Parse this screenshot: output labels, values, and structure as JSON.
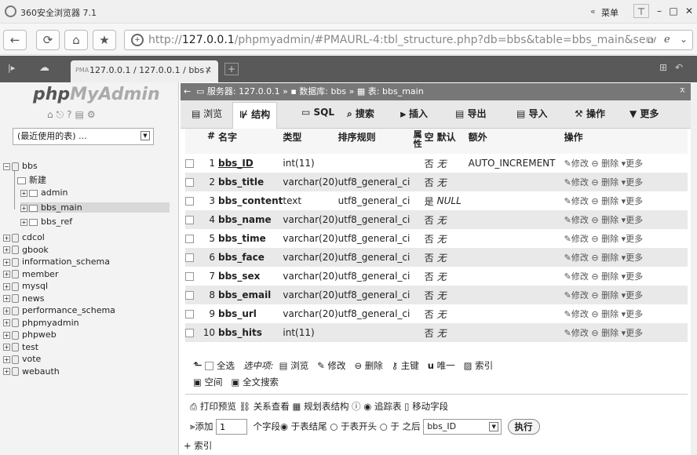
{
  "window": {
    "title": "360安全浏览器 7.1",
    "menu_label": "菜单"
  },
  "address": {
    "url_prefix": "http://",
    "url_host": "127.0.0.1",
    "url_rest": "/phpmyadmin/#PMAURL-4:tbl_structure.php?db=bbs&table=bbs_main&serv"
  },
  "tab": {
    "title": "127.0.0.1 / 127.0.0.1 / bbs /"
  },
  "left": {
    "logo_php": "php",
    "logo_myadmin": "MyAdmin",
    "recent": "(最近使用的表) ...",
    "tree": {
      "bbs": "bbs",
      "new": "新建",
      "admin": "admin",
      "bbs_main": "bbs_main",
      "bbs_ref": "bbs_ref",
      "dbs": [
        "cdcol",
        "gbook",
        "information_schema",
        "member",
        "mysql",
        "news",
        "performance_schema",
        "phpmyadmin",
        "phpweb",
        "test",
        "vote",
        "webauth"
      ]
    }
  },
  "breadcrumb": {
    "server": "服务器: 127.0.0.1",
    "db": "数据库: bbs",
    "table": "表: bbs_main"
  },
  "tabs": {
    "browse": "浏览",
    "structure": "结构",
    "sql": "SQL",
    "search": "搜索",
    "insert": "插入",
    "export": "导出",
    "import": "导入",
    "operations": "操作",
    "more": "更多"
  },
  "headers": {
    "num": "#",
    "name": "名字",
    "type": "类型",
    "collation": "排序规则",
    "attr": "属性",
    "null": "空",
    "default": "默认",
    "extra": "额外",
    "action": "操作"
  },
  "actions": {
    "edit": "修改",
    "drop": "删除",
    "more": "更多"
  },
  "rows": [
    {
      "n": "1",
      "name": "bbs_ID",
      "type": "int(11)",
      "collation": "",
      "null": "否",
      "default": "无",
      "extra": "AUTO_INCREMENT"
    },
    {
      "n": "2",
      "name": "bbs_title",
      "type": "varchar(20)",
      "collation": "utf8_general_ci",
      "null": "否",
      "default": "无",
      "extra": ""
    },
    {
      "n": "3",
      "name": "bbs_content",
      "type": "text",
      "collation": "utf8_general_ci",
      "null": "是",
      "default": "NULL",
      "extra": ""
    },
    {
      "n": "4",
      "name": "bbs_name",
      "type": "varchar(20)",
      "collation": "utf8_general_ci",
      "null": "否",
      "default": "无",
      "extra": ""
    },
    {
      "n": "5",
      "name": "bbs_time",
      "type": "varchar(20)",
      "collation": "utf8_general_ci",
      "null": "否",
      "default": "无",
      "extra": ""
    },
    {
      "n": "6",
      "name": "bbs_face",
      "type": "varchar(20)",
      "collation": "utf8_general_ci",
      "null": "否",
      "default": "无",
      "extra": ""
    },
    {
      "n": "7",
      "name": "bbs_sex",
      "type": "varchar(20)",
      "collation": "utf8_general_ci",
      "null": "否",
      "default": "无",
      "extra": ""
    },
    {
      "n": "8",
      "name": "bbs_email",
      "type": "varchar(20)",
      "collation": "utf8_general_ci",
      "null": "否",
      "default": "无",
      "extra": ""
    },
    {
      "n": "9",
      "name": "bbs_url",
      "type": "varchar(20)",
      "collation": "utf8_general_ci",
      "null": "否",
      "default": "无",
      "extra": ""
    },
    {
      "n": "10",
      "name": "bbs_hits",
      "type": "int(11)",
      "collation": "",
      "null": "否",
      "default": "无",
      "extra": ""
    }
  ],
  "bulk": {
    "check_all": "全选",
    "with_selected": "选中项:",
    "browse": "浏览",
    "change": "修改",
    "drop": "删除",
    "primary": "主键",
    "unique": "唯一",
    "index": "索引",
    "spatial": "空间",
    "fulltext": "全文搜索"
  },
  "bottom": {
    "print": "打印预览",
    "relation": "关系查看",
    "propose": "规划表结构",
    "track": "追踪表",
    "move": "移动字段",
    "add": "添加",
    "add_count": "1",
    "fields": "个字段",
    "at_end": "于表结尾",
    "at_begin": "于表开头",
    "after": "于",
    "after2": "之后",
    "after_field": "bbs_ID",
    "go": "执行",
    "indexes": "+ 索引"
  }
}
